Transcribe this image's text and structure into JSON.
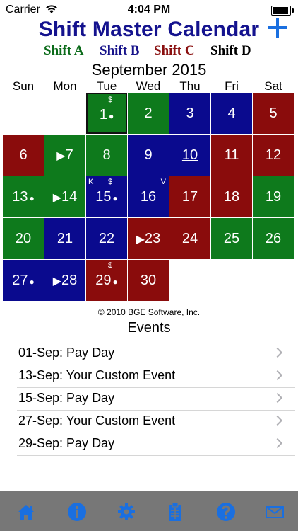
{
  "status_bar": {
    "carrier": "Carrier",
    "time": "4:04 PM"
  },
  "header": {
    "title": "Shift Master Calendar",
    "add_icon": "plus-icon"
  },
  "shifts": [
    {
      "label": "Shift A",
      "color": "#0b6b1a"
    },
    {
      "label": "Shift B",
      "color": "#16128a"
    },
    {
      "label": "Shift C",
      "color": "#8a1010"
    },
    {
      "label": "Shift D",
      "color": "#000000"
    }
  ],
  "calendar": {
    "month_label": "September 2015",
    "weekdays": [
      "Sun",
      "Mon",
      "Tue",
      "Wed",
      "Thu",
      "Fri",
      "Sat"
    ],
    "colors": {
      "A": "#0e7a1c",
      "B": "#0a0a8e",
      "C": "#8a0c0c"
    },
    "days": [
      {
        "day": "1",
        "shift": "A",
        "col": 2,
        "row": 0,
        "dot": true,
        "pay": true,
        "selected": true
      },
      {
        "day": "2",
        "shift": "A",
        "col": 3,
        "row": 0
      },
      {
        "day": "3",
        "shift": "B",
        "col": 4,
        "row": 0
      },
      {
        "day": "4",
        "shift": "B",
        "col": 5,
        "row": 0
      },
      {
        "day": "5",
        "shift": "C",
        "col": 6,
        "row": 0
      },
      {
        "day": "6",
        "shift": "C",
        "col": 0,
        "row": 1
      },
      {
        "day": "7",
        "shift": "A",
        "col": 1,
        "row": 1,
        "arrow": true
      },
      {
        "day": "8",
        "shift": "A",
        "col": 2,
        "row": 1
      },
      {
        "day": "9",
        "shift": "B",
        "col": 3,
        "row": 1
      },
      {
        "day": "10",
        "shift": "B",
        "col": 4,
        "row": 1,
        "today": true
      },
      {
        "day": "11",
        "shift": "C",
        "col": 5,
        "row": 1
      },
      {
        "day": "12",
        "shift": "C",
        "col": 6,
        "row": 1
      },
      {
        "day": "13",
        "shift": "A",
        "col": 0,
        "row": 2,
        "dot": true
      },
      {
        "day": "14",
        "shift": "A",
        "col": 1,
        "row": 2,
        "arrow": true
      },
      {
        "day": "15",
        "shift": "B",
        "col": 2,
        "row": 2,
        "dot": true,
        "pay": true,
        "k": true
      },
      {
        "day": "16",
        "shift": "B",
        "col": 3,
        "row": 2,
        "v": true
      },
      {
        "day": "17",
        "shift": "C",
        "col": 4,
        "row": 2
      },
      {
        "day": "18",
        "shift": "C",
        "col": 5,
        "row": 2
      },
      {
        "day": "19",
        "shift": "A",
        "col": 6,
        "row": 2
      },
      {
        "day": "20",
        "shift": "A",
        "col": 0,
        "row": 3
      },
      {
        "day": "21",
        "shift": "B",
        "col": 1,
        "row": 3
      },
      {
        "day": "22",
        "shift": "B",
        "col": 2,
        "row": 3
      },
      {
        "day": "23",
        "shift": "C",
        "col": 3,
        "row": 3,
        "arrow": true
      },
      {
        "day": "24",
        "shift": "C",
        "col": 4,
        "row": 3
      },
      {
        "day": "25",
        "shift": "A",
        "col": 5,
        "row": 3
      },
      {
        "day": "26",
        "shift": "A",
        "col": 6,
        "row": 3
      },
      {
        "day": "27",
        "shift": "B",
        "col": 0,
        "row": 4,
        "dot": true
      },
      {
        "day": "28",
        "shift": "B",
        "col": 1,
        "row": 4,
        "arrow": true
      },
      {
        "day": "29",
        "shift": "C",
        "col": 2,
        "row": 4,
        "dot": true,
        "pay": true
      },
      {
        "day": "30",
        "shift": "C",
        "col": 3,
        "row": 4
      }
    ],
    "marks": {
      "pay": "$",
      "k": "K",
      "v": "V",
      "dot": "●",
      "arrow": "▶"
    }
  },
  "copyright": "© 2010 BGE Software, Inc.",
  "events": {
    "title": "Events",
    "items": [
      {
        "label": "01-Sep: Pay Day"
      },
      {
        "label": "13-Sep: Your Custom Event"
      },
      {
        "label": "15-Sep: Pay Day"
      },
      {
        "label": "27-Sep: Your Custom Event"
      },
      {
        "label": "29-Sep: Pay Day"
      }
    ]
  },
  "tabbar": {
    "color": "#1a6fe0",
    "tabs": [
      {
        "icon": "home-icon"
      },
      {
        "icon": "info-icon"
      },
      {
        "icon": "gear-icon"
      },
      {
        "icon": "clipboard-icon"
      },
      {
        "icon": "help-icon"
      },
      {
        "icon": "mail-icon"
      }
    ]
  }
}
